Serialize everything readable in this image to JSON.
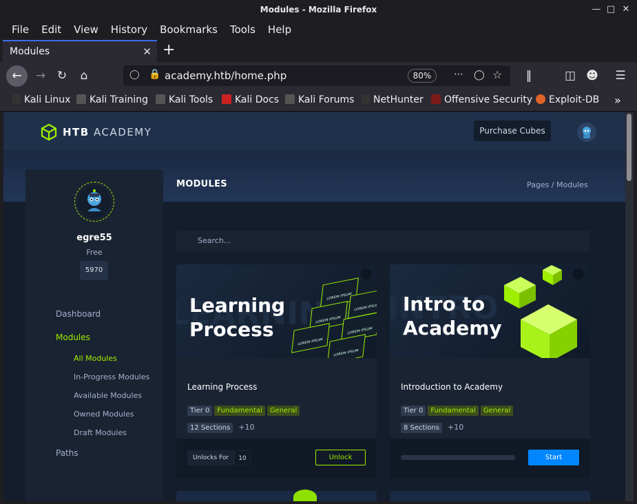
{
  "window": {
    "title": "Modules - Mozilla Firefox"
  },
  "menu": [
    "File",
    "Edit",
    "View",
    "History",
    "Bookmarks",
    "Tools",
    "Help"
  ],
  "tab": {
    "title": "Modules"
  },
  "urlbar": {
    "url": "academy.htb/home.php",
    "zoom": "80%"
  },
  "bookmarks": [
    "Kali Linux",
    "Kali Training",
    "Kali Tools",
    "Kali Docs",
    "Kali Forums",
    "NetHunter",
    "Offensive Security",
    "Exploit-DB"
  ],
  "site": {
    "logo_bold": "HTB",
    "logo_rest": "ACADEMY",
    "purchase": "Purchase Cubes",
    "heading": "MODULES",
    "breadcrumb": "Pages  /  Modules",
    "search_placeholder": "Search..."
  },
  "sidebar": {
    "username": "egre55",
    "plan": "Free",
    "cubes": "5970",
    "nav": [
      "Dashboard",
      "Modules",
      "Paths"
    ],
    "sub": [
      "All Modules",
      "In-Progress Modules",
      "Available Modules",
      "Owned Modules",
      "Draft Modules"
    ]
  },
  "cards": [
    {
      "banner_line1": "Learning",
      "banner_line2": "Process",
      "title": "Learning Process",
      "tier": "Tier 0",
      "tags": [
        "Fundamental",
        "General"
      ],
      "sections": "12 Sections",
      "xp": "+10",
      "unlock_label": "Unlocks For",
      "unlock_value": "10",
      "action": "Unlock",
      "lorem": "LOREM IPSUM"
    },
    {
      "banner_line1": "Intro to",
      "banner_line2": "Academy",
      "title": "Introduction to Academy",
      "tier": "Tier 0",
      "tags": [
        "Fundamental",
        "General"
      ],
      "sections": "8 Sections",
      "xp": "+10",
      "action": "Start"
    }
  ],
  "colors": {
    "accent": "#9fef00",
    "start": "#0086ff",
    "bg": "#141d2b"
  }
}
